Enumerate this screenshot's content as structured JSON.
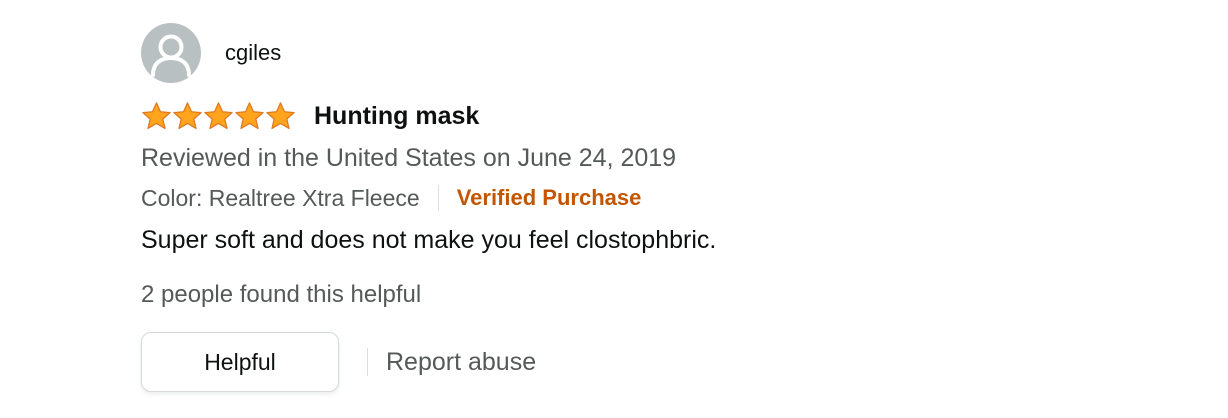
{
  "review": {
    "profile_name": "cgiles",
    "rating": 5,
    "rating_max": 5,
    "title": "Hunting mask",
    "date_line": "Reviewed in the United States on June 24, 2019",
    "variant": "Color: Realtree Xtra Fleece",
    "verified_label": "Verified Purchase",
    "body": "Super soft and does not make you feel clostophbric.",
    "helpful_count_text": "2 people found this helpful",
    "helpful_button_label": "Helpful",
    "report_label": "Report abuse"
  },
  "colors": {
    "star": "#ffa41c",
    "star_outline": "#de7921",
    "verified": "#c45500",
    "secondary_text": "#565959",
    "avatar_bg": "#b9c0c2"
  },
  "icons": {
    "avatar": "user-silhouette-icon",
    "star": "star-icon"
  }
}
